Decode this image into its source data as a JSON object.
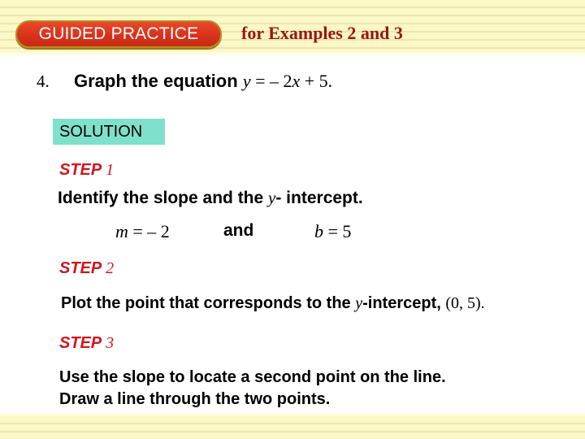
{
  "header": {
    "badge_label": "GUIDED PRACTICE",
    "subtitle": "for Examples 2 and 3"
  },
  "problem": {
    "number": "4.",
    "instruction": "Graph the equation",
    "equation_y": "y",
    "equation_rest_1": " = – 2",
    "equation_x": "x",
    "equation_rest_2": " + 5."
  },
  "solution_label": "SOLUTION",
  "steps": [
    {
      "label": "STEP",
      "number": "1",
      "text_before": "Identify the slope and the ",
      "text_var": "y",
      "text_after": "- intercept."
    },
    {
      "label": "STEP",
      "number": "2",
      "text_before": "Plot the point that corresponds to the ",
      "text_var": "y",
      "text_after": "-intercept, ",
      "text_point": "(0, 5)."
    },
    {
      "label": "STEP",
      "number": "3",
      "line1": "Use the slope to locate a second point on the line.",
      "line2": "Draw a line through the two points."
    }
  ],
  "slope_intercept": {
    "m_var": "m",
    "m_value": " = – 2",
    "connector": "and",
    "b_var": "b",
    "b_value": " = 5"
  },
  "colors": {
    "badge": "#d8301a",
    "subtitle": "#9a1414",
    "solution_bg": "#7fe0cc",
    "step_label": "#d2161c",
    "band": "#fbf7c6"
  }
}
